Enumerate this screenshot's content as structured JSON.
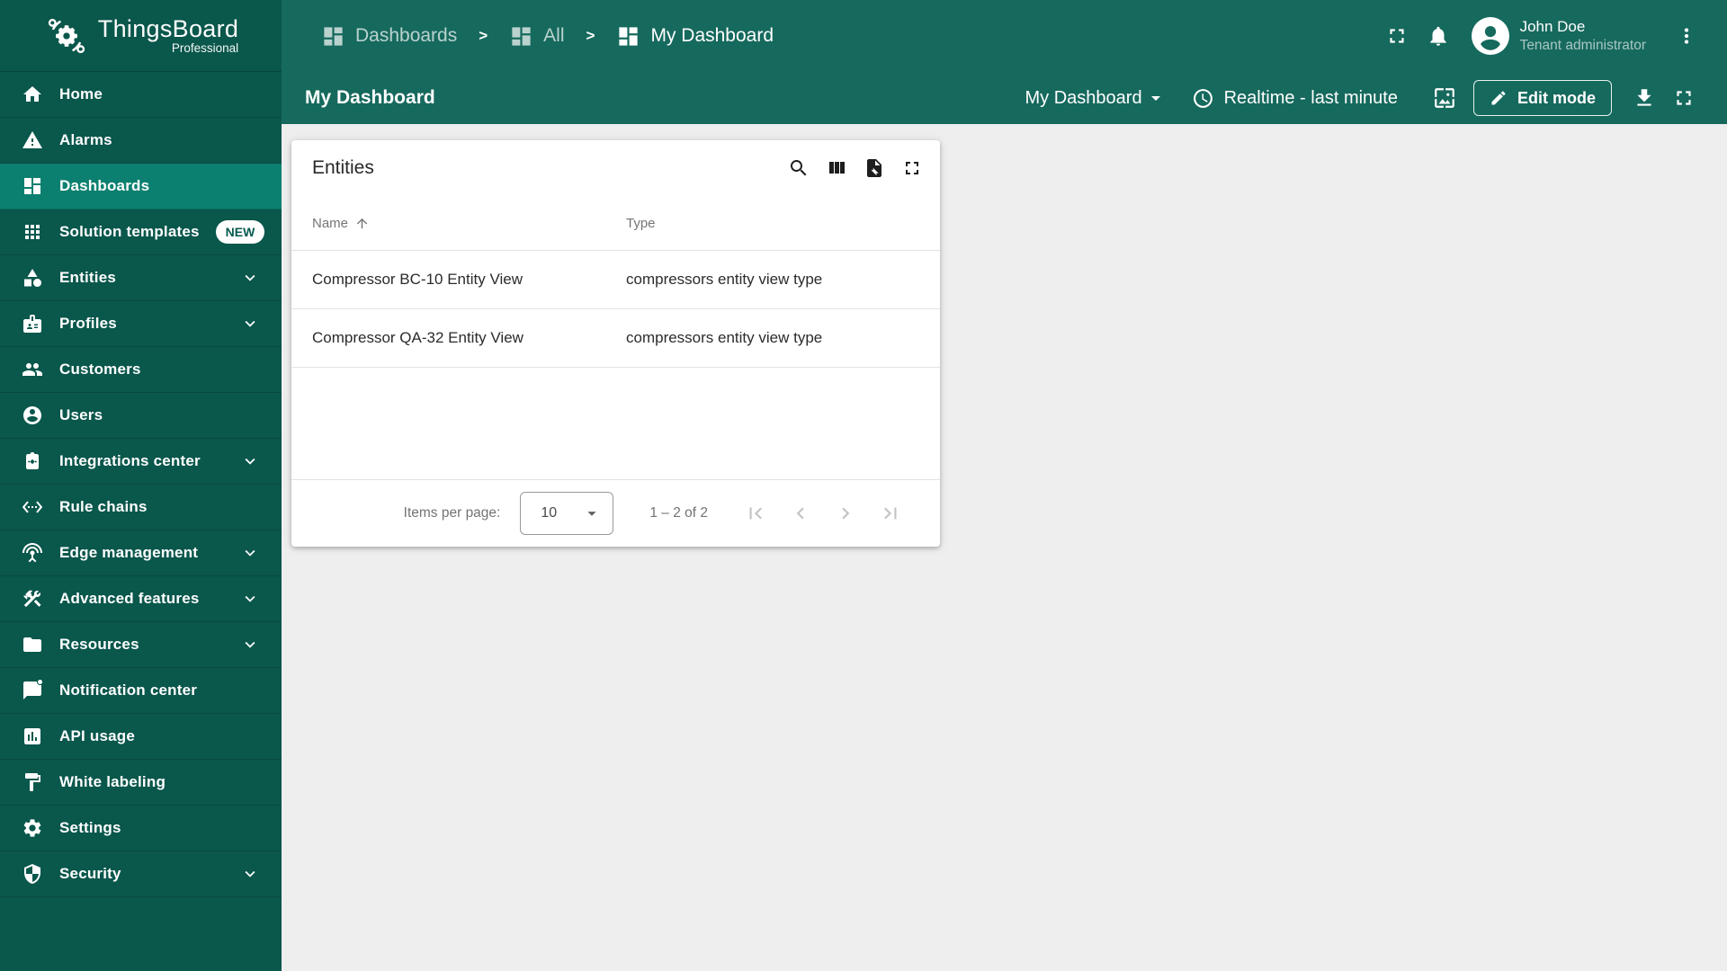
{
  "colors": {
    "sidebar_bg": "#0A574C",
    "sidebar_selected_bg": "#0C8070",
    "header_bg": "#16695D",
    "content_bg": "#EEEEEE",
    "card_bg": "#FFFFFF",
    "badge_bg": "#FFFFFF",
    "badge_text": "#075B50"
  },
  "app": {
    "name": "ThingsBoard",
    "edition": "Professional"
  },
  "sidebar": {
    "items": [
      {
        "label": "Home",
        "icon": "home"
      },
      {
        "label": "Alarms",
        "icon": "warning"
      },
      {
        "label": "Dashboards",
        "icon": "dashboard",
        "selected": true
      },
      {
        "label": "Solution templates",
        "icon": "apps",
        "badge": "NEW"
      },
      {
        "label": "Entities",
        "icon": "category",
        "expandable": true
      },
      {
        "label": "Profiles",
        "icon": "badge",
        "expandable": true
      },
      {
        "label": "Customers",
        "icon": "group"
      },
      {
        "label": "Users",
        "icon": "account-circle"
      },
      {
        "label": "Integrations center",
        "icon": "integration",
        "expandable": true
      },
      {
        "label": "Rule chains",
        "icon": "settings-ethernet"
      },
      {
        "label": "Edge management",
        "icon": "antenna",
        "expandable": true
      },
      {
        "label": "Advanced features",
        "icon": "construction",
        "expandable": true
      },
      {
        "label": "Resources",
        "icon": "folder",
        "expandable": true
      },
      {
        "label": "Notification center",
        "icon": "chat-unread"
      },
      {
        "label": "API usage",
        "icon": "assessment"
      },
      {
        "label": "White labeling",
        "icon": "format-paint"
      },
      {
        "label": "Settings",
        "icon": "settings-gear"
      },
      {
        "label": "Security",
        "icon": "security-shield",
        "expandable": true
      }
    ]
  },
  "topbar": {
    "breadcrumb": [
      {
        "label": "Dashboards"
      },
      {
        "label": "All"
      },
      {
        "label": "My Dashboard"
      }
    ],
    "separator": ">",
    "user": {
      "name": "John Doe",
      "role": "Tenant administrator"
    }
  },
  "toolbar": {
    "title": "My Dashboard",
    "state_selector": "My Dashboard",
    "timewindow": "Realtime - last minute",
    "edit_button": "Edit mode"
  },
  "widget": {
    "title": "Entities",
    "table": {
      "columns": [
        {
          "label": "Name",
          "sorted": "asc"
        },
        {
          "label": "Type"
        }
      ],
      "rows": [
        {
          "name": "Compressor BC-10 Entity View",
          "type": "compressors entity view type"
        },
        {
          "name": "Compressor QA-32 Entity View",
          "type": "compressors entity view type"
        }
      ]
    },
    "paginator": {
      "items_per_page_label": "Items per page:",
      "items_per_page": "10",
      "range_label": "1 – 2 of 2"
    }
  }
}
